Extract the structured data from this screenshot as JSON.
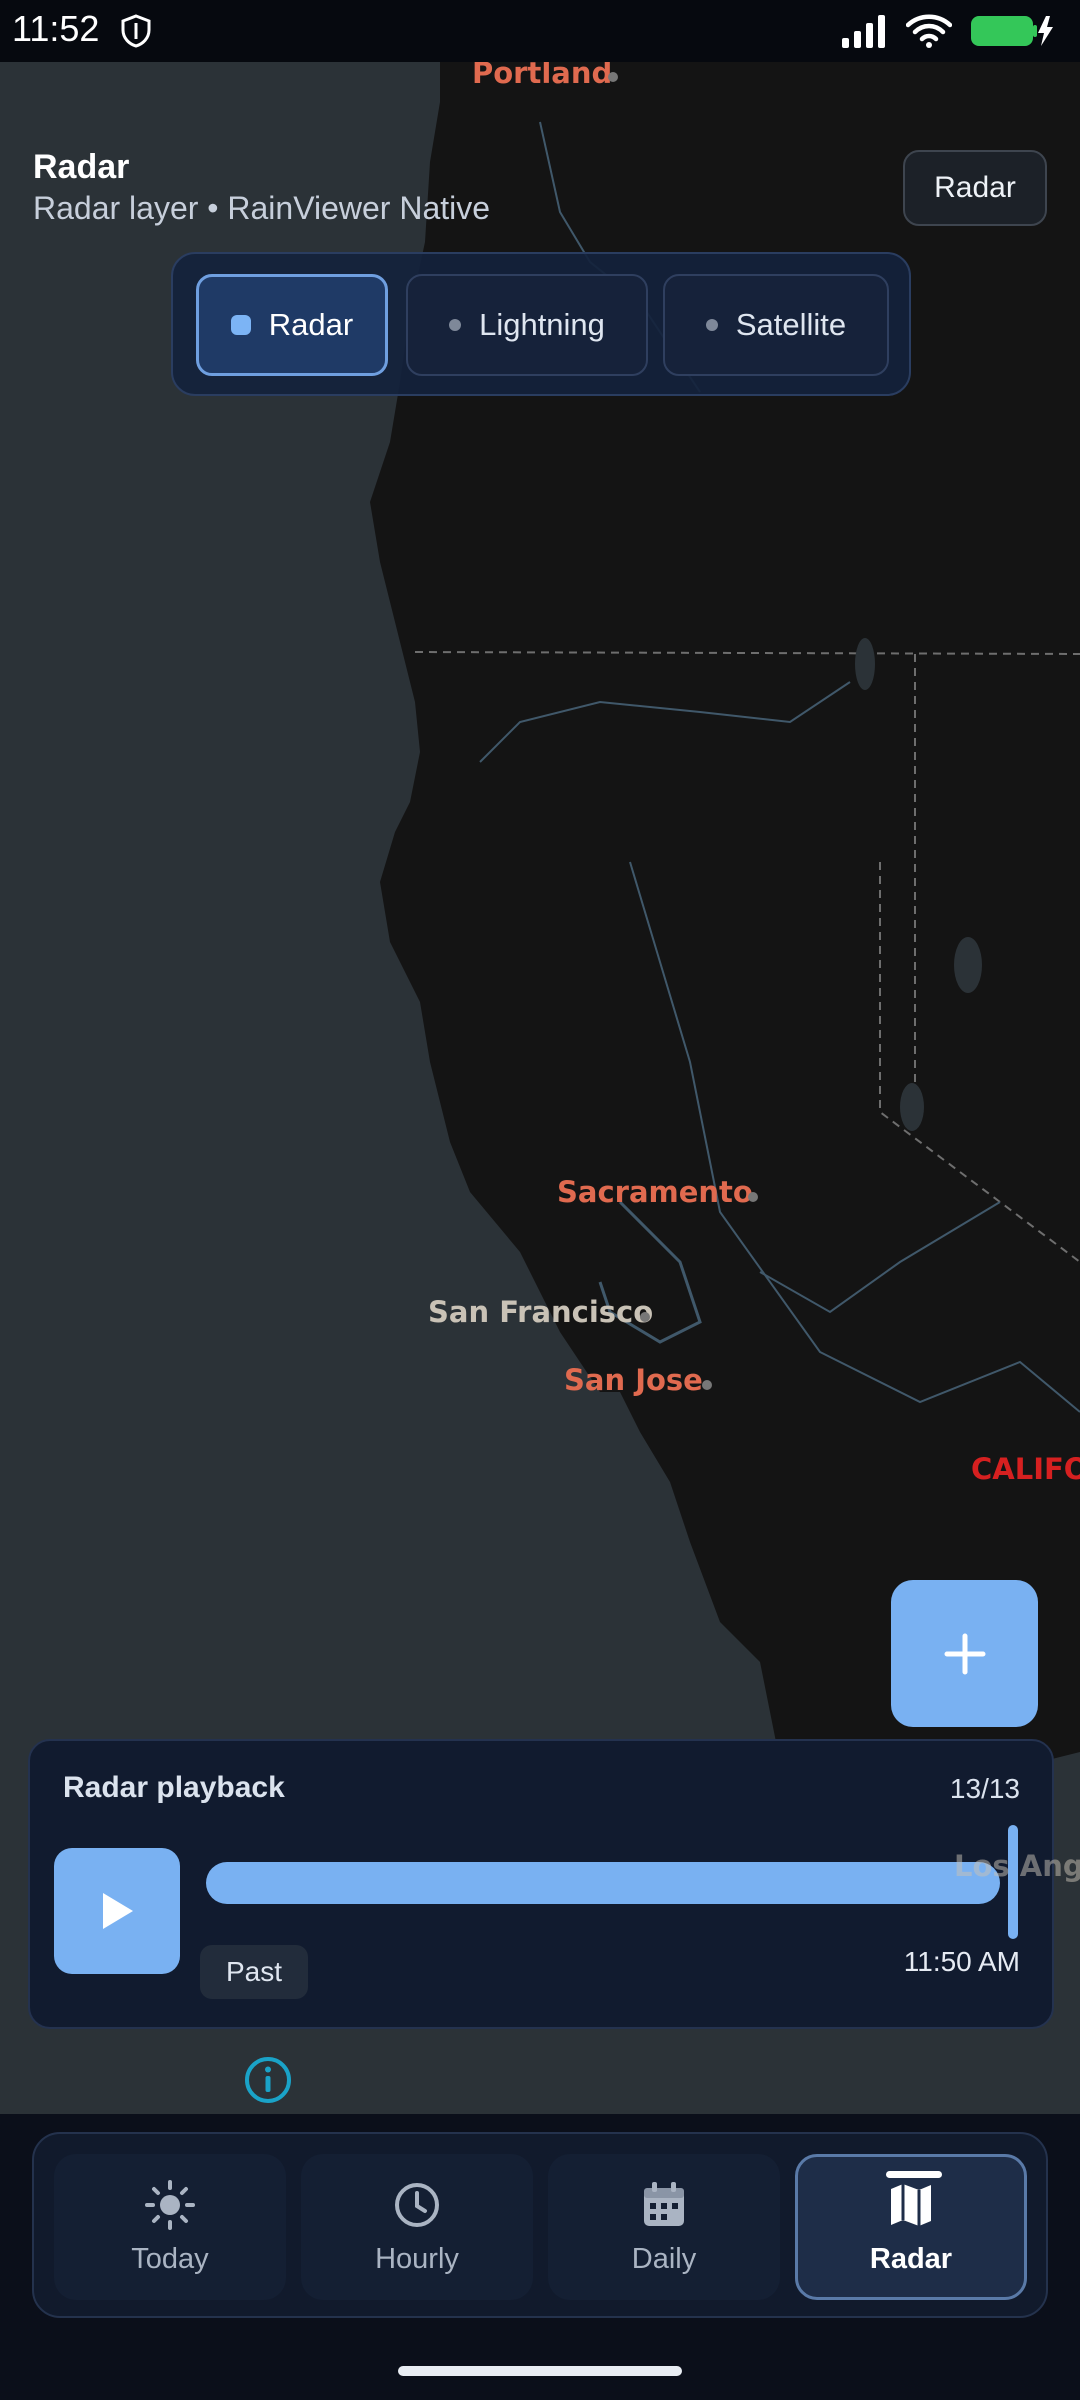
{
  "status_bar": {
    "time": "11:52"
  },
  "header": {
    "title": "Radar",
    "subtitle": "Radar layer • RainViewer Native",
    "radar_button": "Radar"
  },
  "layers": [
    {
      "label": "Radar",
      "active": true
    },
    {
      "label": "Lightning",
      "active": false
    },
    {
      "label": "Satellite",
      "active": false
    }
  ],
  "map": {
    "cities": {
      "portland": "Portland",
      "sacramento": "Sacramento",
      "san_francisco": "San Francisco",
      "san_jose": "San Jose",
      "california": "CALIFO",
      "los_angeles": "Los Ange"
    },
    "zoom_in_icon": "plus-icon"
  },
  "playback": {
    "title": "Radar playback",
    "frame_count": "13/13",
    "progress": 1.0,
    "past_label": "Past",
    "time": "11:50 AM"
  },
  "nav": [
    {
      "label": "Today",
      "icon": "sun-icon"
    },
    {
      "label": "Hourly",
      "icon": "clock-icon"
    },
    {
      "label": "Daily",
      "icon": "calendar-icon"
    },
    {
      "label": "Radar",
      "icon": "map-icon",
      "active": true
    }
  ]
}
